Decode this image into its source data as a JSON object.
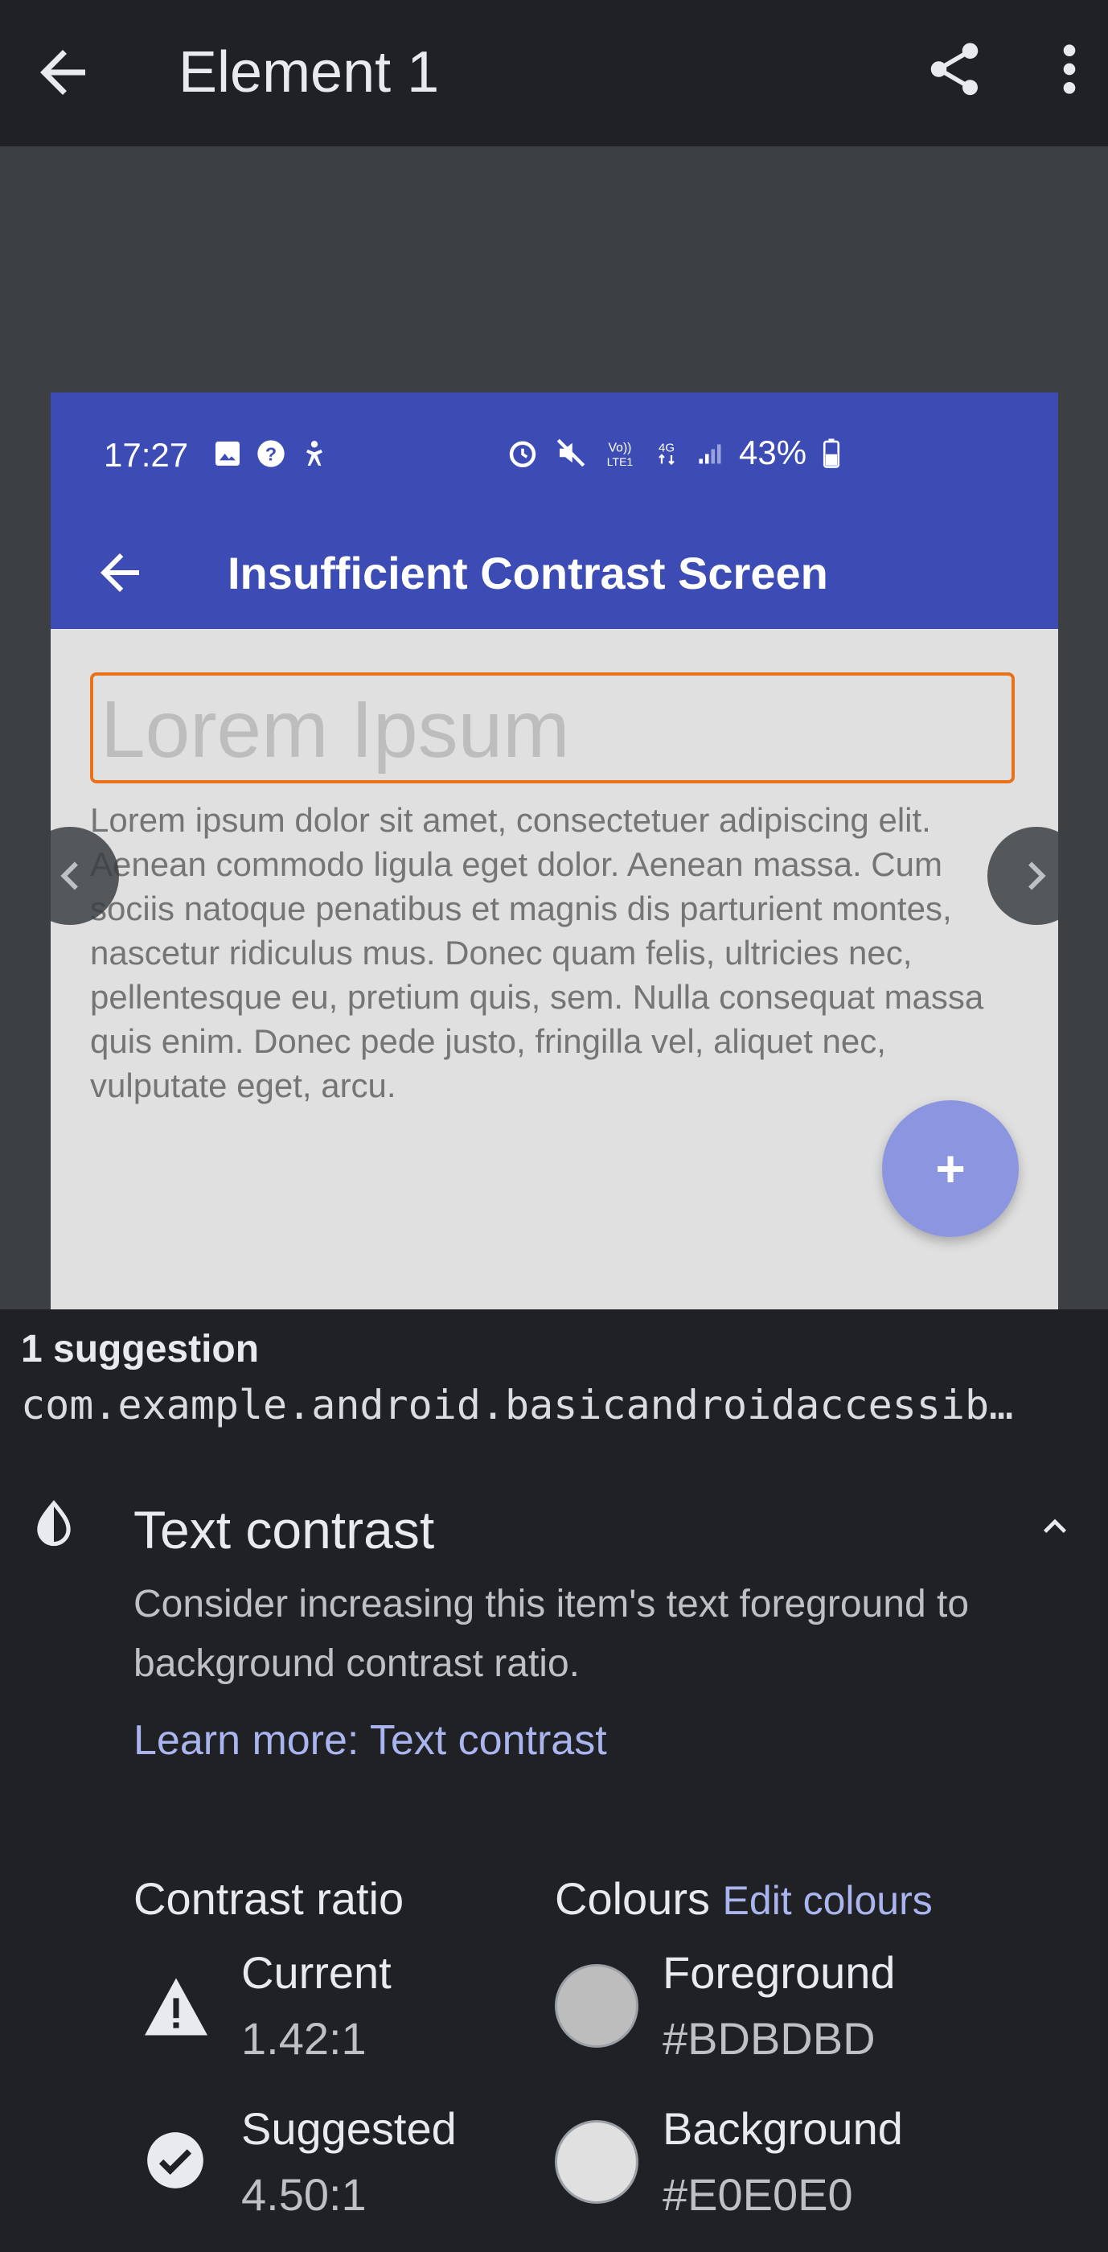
{
  "app_bar": {
    "title": "Element 1"
  },
  "screenshot": {
    "status": {
      "time": "17:27",
      "battery": "43%"
    },
    "app_title": "Insufficient Contrast Screen",
    "heading": "Lorem Ipsum",
    "body": "Lorem ipsum dolor sit amet, consectetuer adipiscing elit. Aenean commodo ligula eget dolor. Aenean massa. Cum sociis natoque penatibus et magnis dis parturient montes, nascetur ridiculus mus. Donec quam felis, ultricies nec, pellentesque eu, pretium quis, sem. Nulla consequat massa quis enim. Donec pede justo, fringilla vel, aliquet nec, vulputate eget, arcu.",
    "fab_label": "+"
  },
  "sheet": {
    "count": "1 suggestion",
    "package": "com.example.android.basicandroidaccessib…",
    "rule_title": "Text contrast",
    "description": "Consider increasing this item's text foreground to background contrast ratio.",
    "learn_more": "Learn more: Text contrast",
    "contrast_heading": "Contrast ratio",
    "colours_heading": "Colours",
    "edit_colours": "Edit colours",
    "current_label": "Current",
    "current_value": "1.42:1",
    "suggested_label": "Suggested",
    "suggested_value": "4.50:1",
    "foreground_label": "Foreground",
    "foreground_value": "#BDBDBD",
    "background_label": "Background",
    "background_value": "#E0E0E0"
  },
  "colors": {
    "foreground_swatch": "#BDBDBD",
    "background_swatch": "#E0E0E0",
    "highlight": "#E8711A",
    "phone_primary": "#3D4CB5"
  },
  "icons": [
    "back-arrow-icon",
    "share-icon",
    "more-vert-icon",
    "contrast-icon",
    "chevron-up-icon",
    "warning-icon",
    "check-circle-icon",
    "chevron-left-icon",
    "chevron-right-icon"
  ]
}
